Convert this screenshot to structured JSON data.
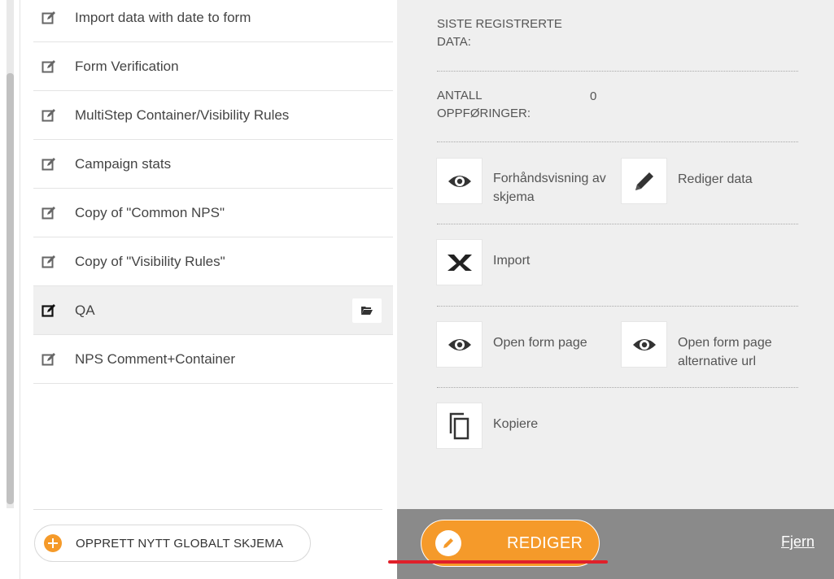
{
  "forms": [
    {
      "label": "Import data with date to form",
      "selected": false
    },
    {
      "label": "Form Verification",
      "selected": false
    },
    {
      "label": "MultiStep Container/Visibility Rules",
      "selected": false
    },
    {
      "label": "Campaign stats",
      "selected": false
    },
    {
      "label": "Copy of \"Common NPS\"",
      "selected": false
    },
    {
      "label": "Copy of \"Visibility Rules\"",
      "selected": false
    },
    {
      "label": "QA",
      "selected": true
    },
    {
      "label": "NPS Comment+Container",
      "selected": false
    }
  ],
  "create_button_label": "OPPRETT NYTT GLOBALT SKJEMA",
  "details": {
    "last_registered_label": "SISTE REGISTRERTE DATA:",
    "count_label": "ANTALL OPPFØRINGER:",
    "count_value": "0"
  },
  "actions": {
    "preview": "Forhåndsvisning av skjema",
    "edit_data": "Rediger data",
    "import": "Import",
    "open_form_page": "Open form page",
    "open_form_page_alt": "Open form page alternative url",
    "copy": "Kopiere"
  },
  "bottom_bar": {
    "edit_button": "REDIGER",
    "remove_link": "Fjern"
  },
  "colors": {
    "accent": "#f59a2a",
    "panel_bg": "#efefef",
    "bottom_bar_bg": "#8a8a8a",
    "highlight_underline": "#e0202a"
  },
  "icons": {
    "form_item": "edit-icon",
    "folder": "folder-open-icon",
    "preview": "eye-icon",
    "edit_data": "pencil-icon",
    "import": "excel-icon",
    "copy": "copy-icon",
    "create": "plus-circle-icon"
  }
}
